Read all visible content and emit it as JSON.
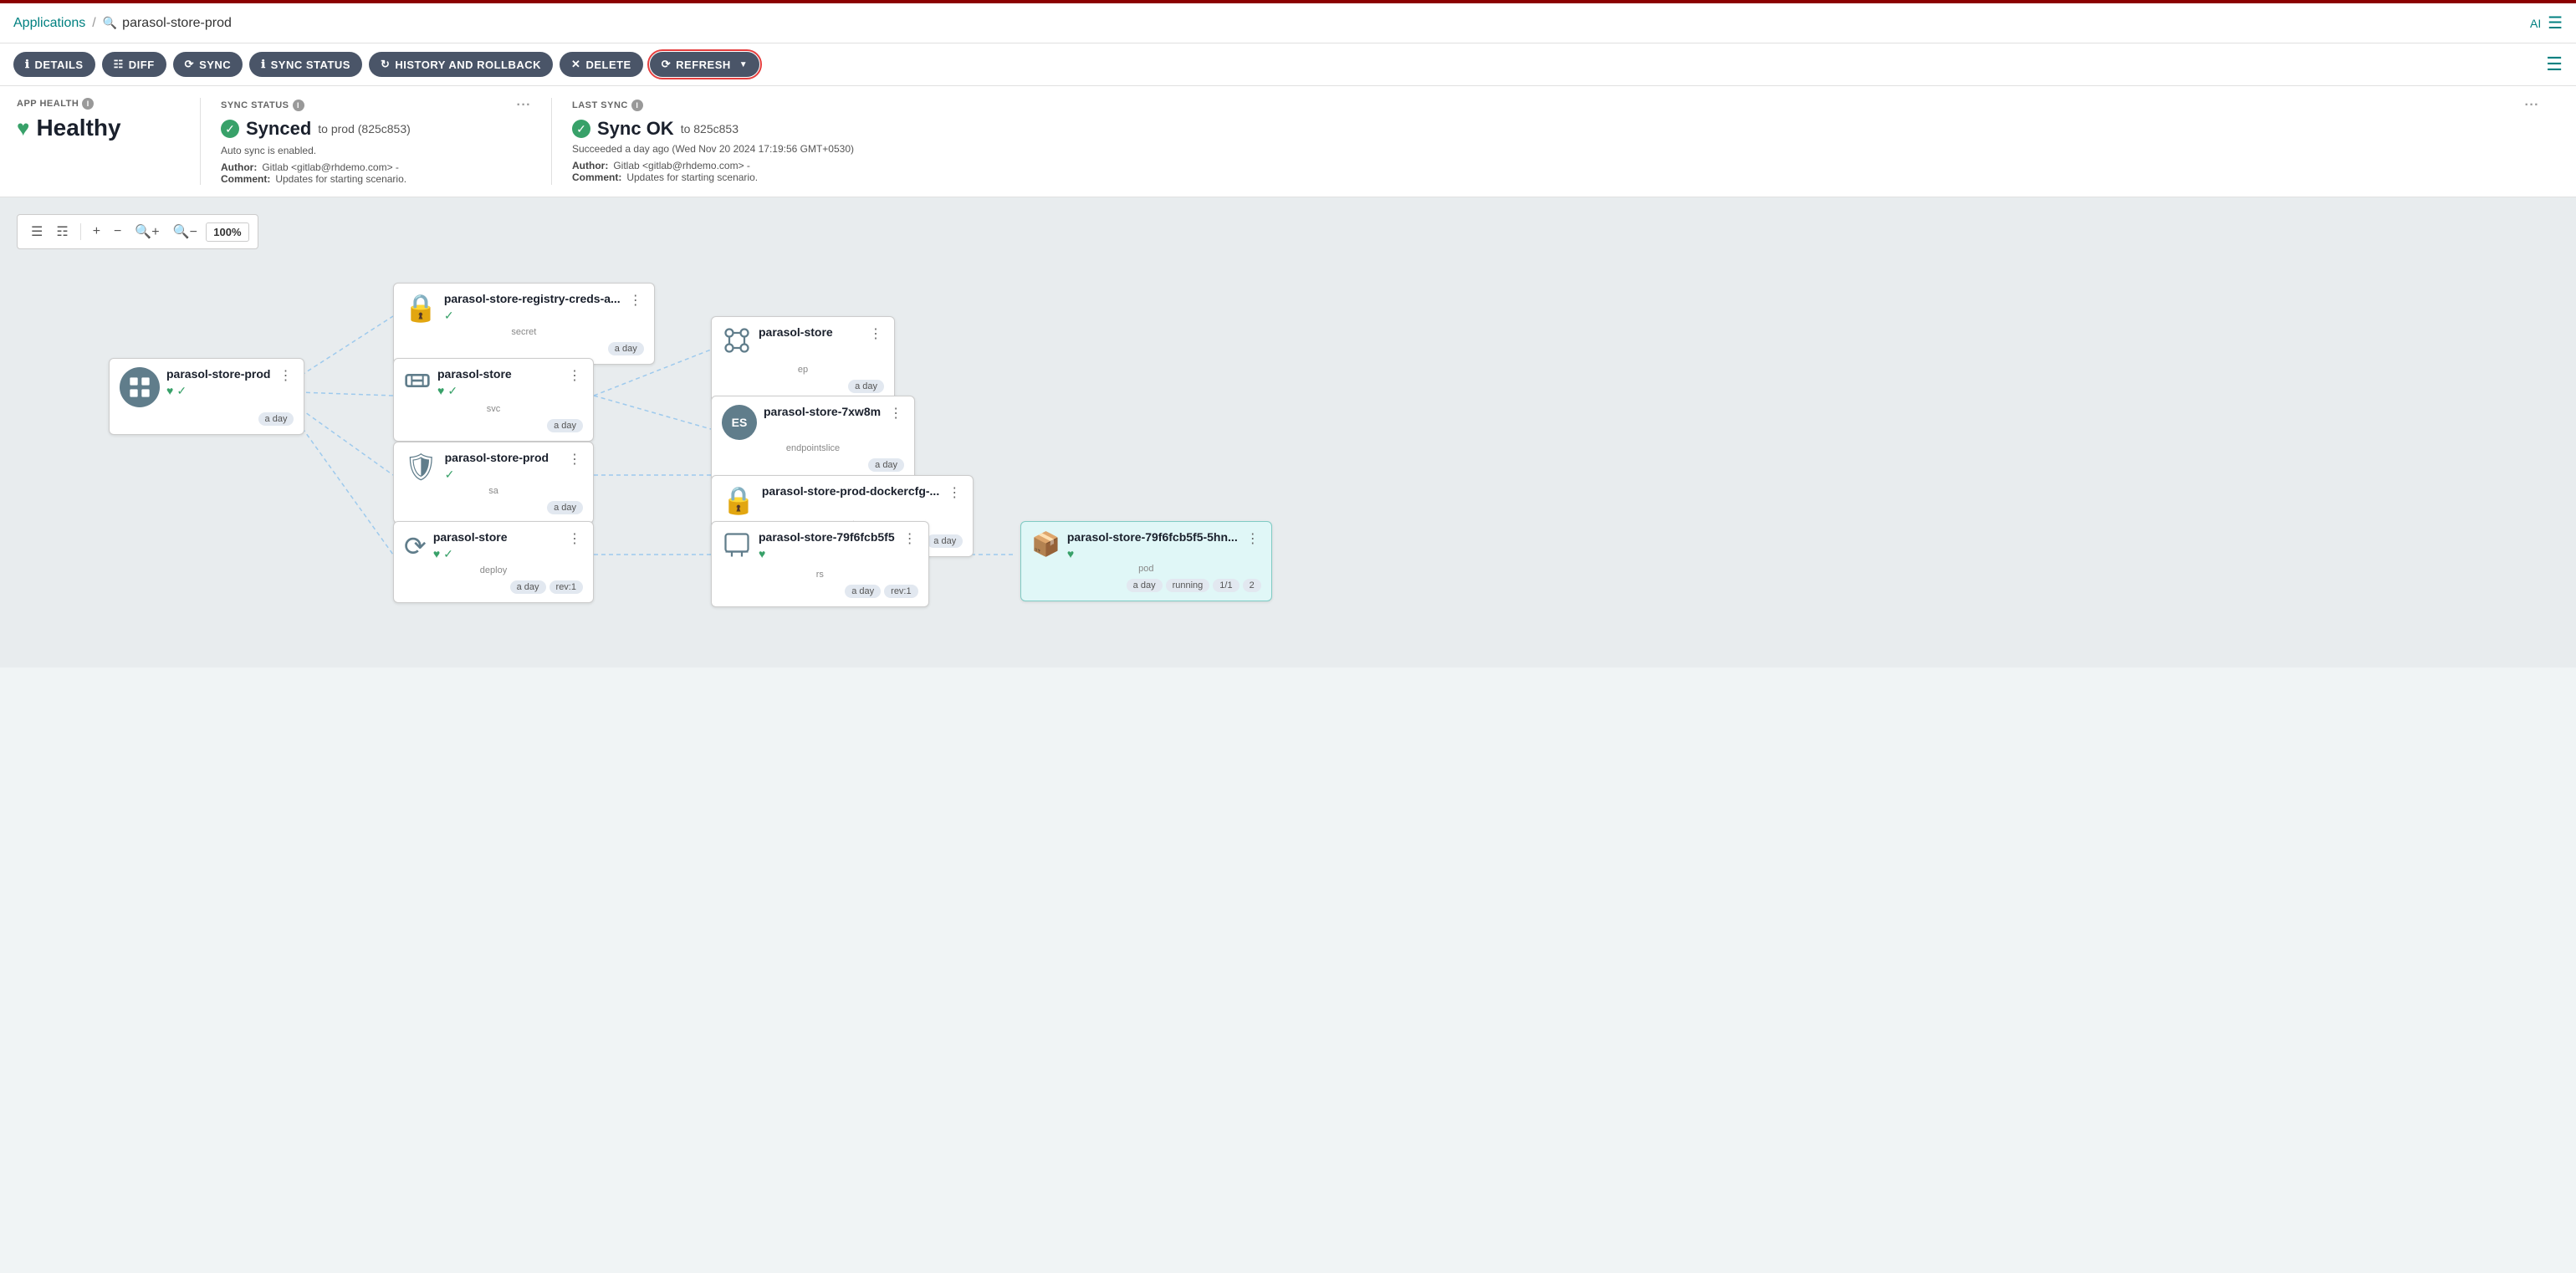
{
  "topbar": {
    "app_link": "Applications",
    "search_text": "parasol-store-prod",
    "top_right_label": "AI"
  },
  "toolbar": {
    "details": "DETAILS",
    "diff": "DIFF",
    "sync": "SYNC",
    "sync_status": "SYNC STATUS",
    "history": "HISTORY AND ROLLBACK",
    "delete": "DELETE",
    "refresh": "REFRESH"
  },
  "panels": {
    "app_health": {
      "header": "APP HEALTH",
      "status": "Healthy"
    },
    "sync_status": {
      "header": "SYNC STATUS",
      "status": "Synced",
      "to_text": "to prod (825c853)",
      "auto_sync": "Auto sync is enabled.",
      "author_label": "Author:",
      "author_value": "Gitlab <gitlab@rhdemo.com> -",
      "comment_label": "Comment:",
      "comment_value": "Updates for starting scenario."
    },
    "last_sync": {
      "header": "LAST SYNC",
      "status": "Sync OK",
      "to_text": "to 825c853",
      "succeeded_text": "Succeeded a day ago (Wed Nov 20 2024 17:19:56 GMT+0530)",
      "author_label": "Author:",
      "author_value": "Gitlab <gitlab@rhdemo.com> -",
      "comment_label": "Comment:",
      "comment_value": "Updates for starting scenario."
    }
  },
  "canvas": {
    "zoom": "100%"
  },
  "nodes": {
    "root": {
      "title": "parasol-store-prod",
      "type": "",
      "tag": "a day"
    },
    "secret1": {
      "title": "parasol-store-registry-creds-a...",
      "type": "secret",
      "tag": "a day"
    },
    "svc": {
      "title": "parasol-store",
      "type": "svc",
      "tag": "a day"
    },
    "sa": {
      "title": "parasol-store-prod",
      "type": "sa",
      "tag": "a day"
    },
    "deploy": {
      "title": "parasol-store",
      "type": "deploy",
      "tag1": "a day",
      "tag2": "rev:1"
    },
    "ep": {
      "title": "parasol-store",
      "type": "ep",
      "tag": "a day"
    },
    "endpointslice": {
      "title": "parasol-store-7xw8m",
      "type": "endpointslice",
      "tag": "a day"
    },
    "secret2": {
      "title": "parasol-store-prod-dockercfg-...",
      "type": "secret",
      "tag": "a day"
    },
    "rs": {
      "title": "parasol-store-79f6fcb5f5",
      "type": "rs",
      "tag1": "a day",
      "tag2": "rev:1"
    },
    "pod": {
      "title": "parasol-store-79f6fcb5f5-5hn...",
      "type": "pod",
      "tag1": "a day",
      "tag2": "running",
      "tag3": "1/1",
      "tag4": "2"
    }
  }
}
